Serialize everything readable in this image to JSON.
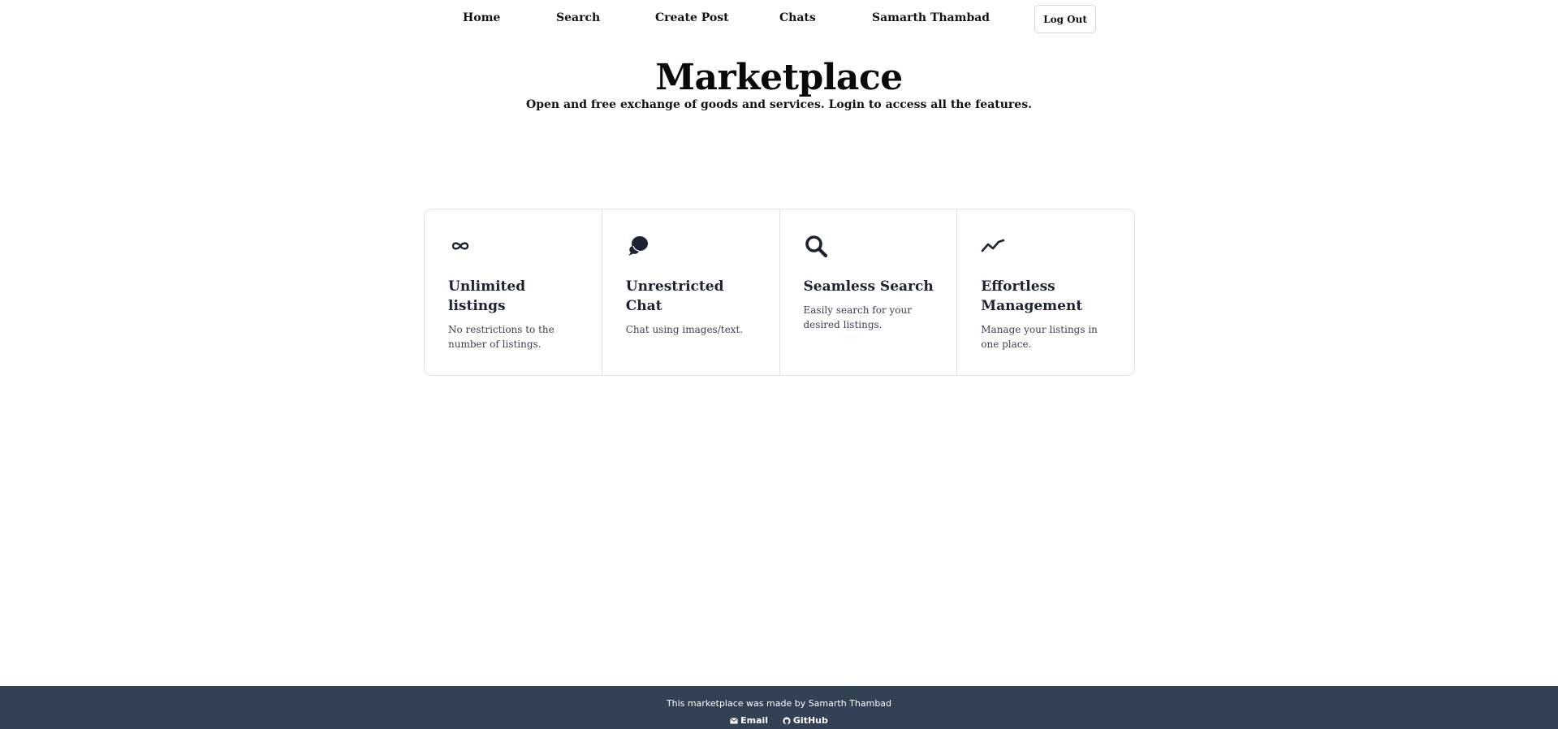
{
  "nav": {
    "home": "Home",
    "search": "Search",
    "create_post": "Create Post",
    "chats": "Chats",
    "profile": "Samarth Thambad",
    "logout": "Log Out"
  },
  "hero": {
    "title": "Marketplace",
    "subtitle": "Open and free exchange of goods and services. Login to access all the features."
  },
  "features": [
    {
      "icon": "infinity-icon",
      "title": "Unlimited listings",
      "description": "No restrictions to the number of listings."
    },
    {
      "icon": "chat-bubbles-icon",
      "title": "Unrestricted Chat",
      "description": "Chat using images/text."
    },
    {
      "icon": "search-icon",
      "title": "Seamless Search",
      "description": "Easily search for your desired listings."
    },
    {
      "icon": "trend-line-icon",
      "title": "Effortless Management",
      "description": "Manage your listings in one place."
    }
  ],
  "footer": {
    "credit": "This marketplace was made by Samarth Thambad",
    "email": "Email",
    "github": "GitHub"
  },
  "colors": {
    "footer_bg": "#334155",
    "icon": "#1a2233",
    "border": "#e3e3e3"
  }
}
